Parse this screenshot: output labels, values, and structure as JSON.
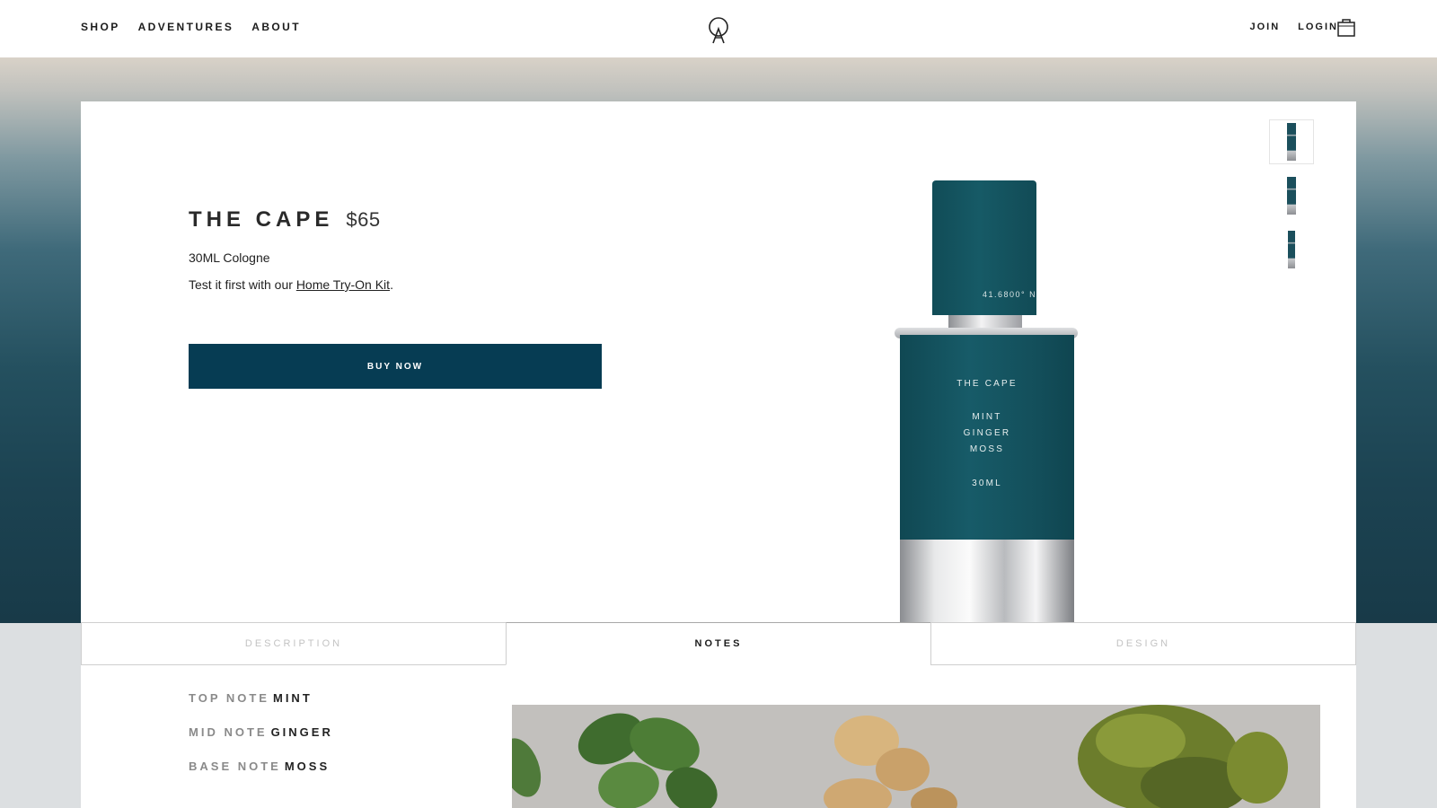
{
  "nav": {
    "left_links": [
      "SHOP",
      "ADVENTURES",
      "ABOUT"
    ],
    "join": "JOIN",
    "login": "LOGIN",
    "logo_icon": "compass-a-logo-icon",
    "cart_icon": "shopping-bag-icon"
  },
  "product": {
    "name": "THE CAPE",
    "price": "$65",
    "subtitle": "30ML Cologne",
    "tryon_prefix": "Test it first with our ",
    "tryon_link": "Home Try-On Kit",
    "tryon_suffix": ".",
    "buy_label": "BUY NOW",
    "thumbnail_count": 3
  },
  "bottle": {
    "cap_text": "41.6800° N,",
    "label_name": "THE CAPE",
    "label_notes": [
      "MINT",
      "GINGER",
      "MOSS"
    ],
    "label_size": "30ML"
  },
  "tabs": [
    {
      "label": "DESCRIPTION",
      "active": false
    },
    {
      "label": "NOTES",
      "active": true
    },
    {
      "label": "DESIGN",
      "active": false
    }
  ],
  "notes": [
    {
      "label": "TOP NOTE",
      "value": "MINT"
    },
    {
      "label": "MID NOTE",
      "value": "GINGER"
    },
    {
      "label": "BASE NOTE",
      "value": "MOSS"
    }
  ],
  "colors": {
    "brand_teal": "#063c53",
    "bottle_teal": "#165a66"
  }
}
